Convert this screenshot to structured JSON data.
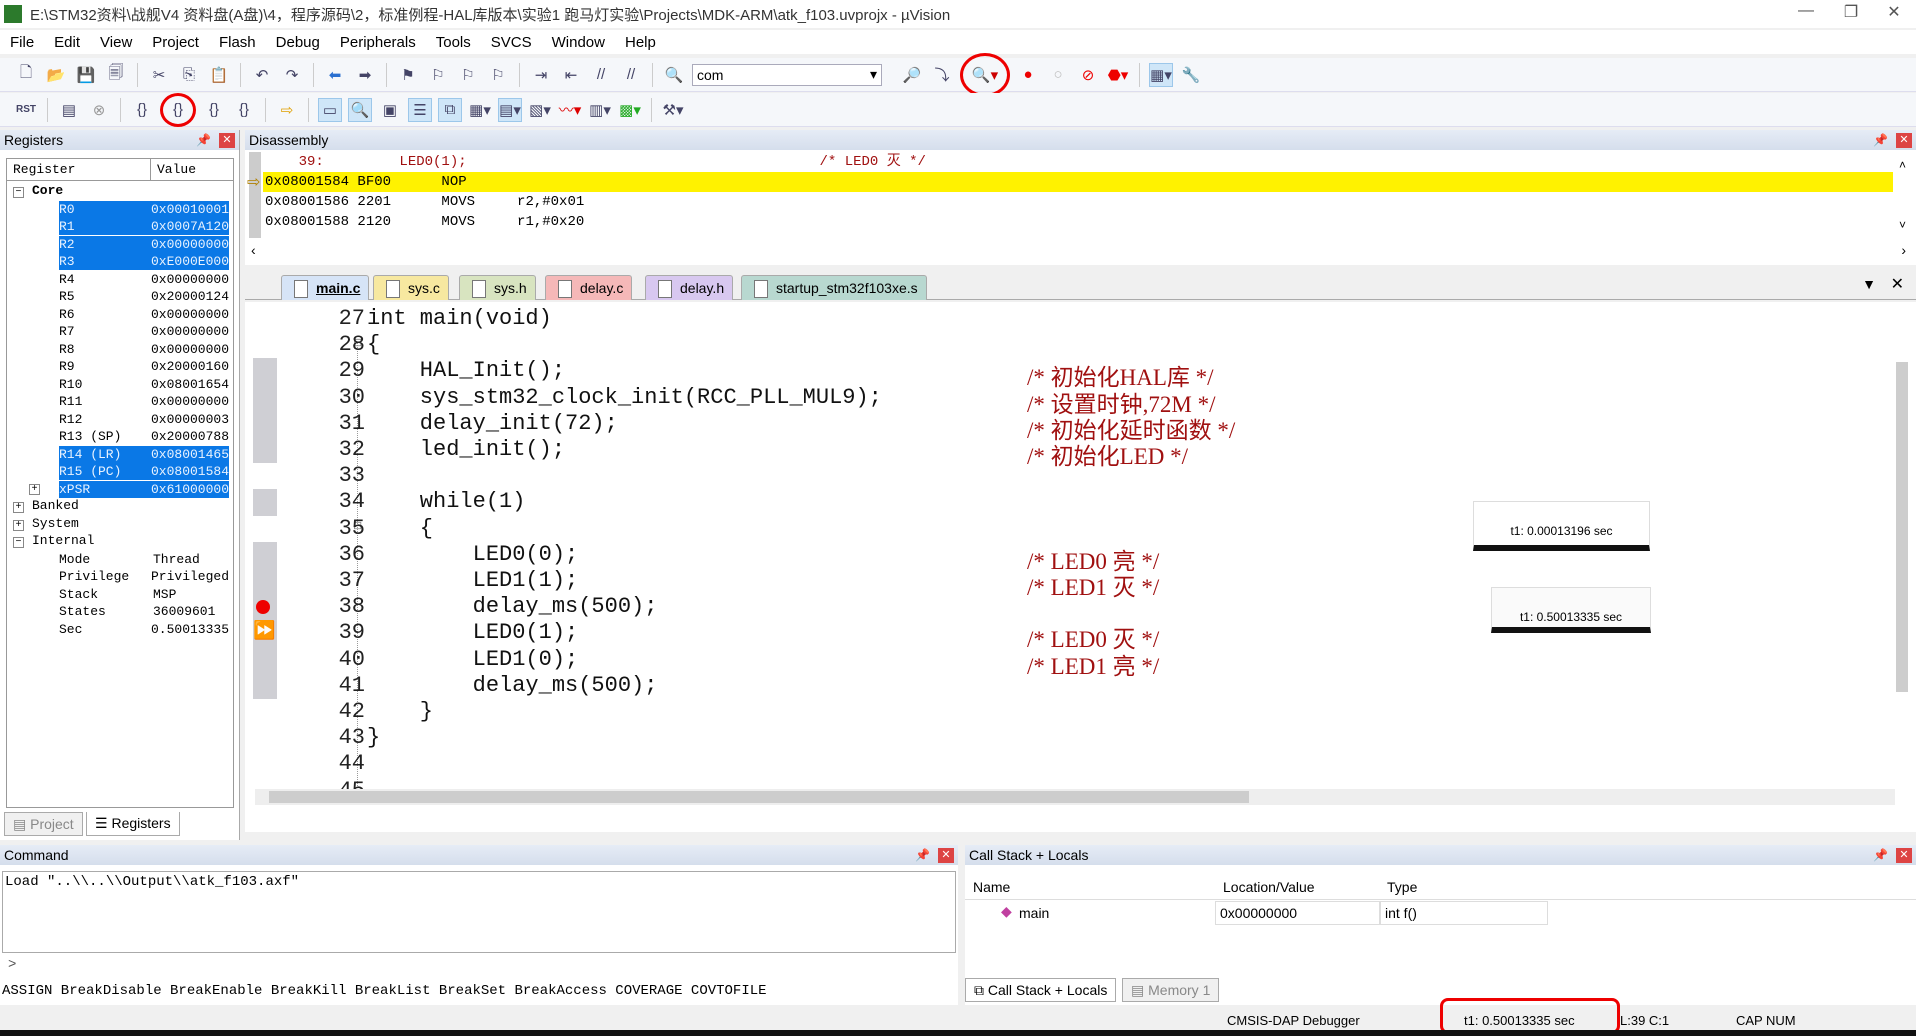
{
  "window": {
    "title": "E:\\STM32资料\\战舰V4 资料盘(A盘)\\4，程序源码\\2，标准例程-HAL库版本\\实验1 跑马灯实验\\Projects\\MDK-ARM\\atk_f103.uvprojx - µVision",
    "logo": "V"
  },
  "menu": [
    "File",
    "Edit",
    "View",
    "Project",
    "Flash",
    "Debug",
    "Peripherals",
    "Tools",
    "SVCS",
    "Window",
    "Help"
  ],
  "toolbar": {
    "target_combo": "com"
  },
  "registers": {
    "title": "Registers",
    "col_register": "Register",
    "col_value": "Value",
    "core_label": "Core",
    "core": [
      {
        "name": "R0",
        "value": "0x00010001",
        "selected": true
      },
      {
        "name": "R1",
        "value": "0x0007A120",
        "selected": true
      },
      {
        "name": "R2",
        "value": "0x00000000",
        "selected": true
      },
      {
        "name": "R3",
        "value": "0xE000E000",
        "selected": true
      },
      {
        "name": "R4",
        "value": "0x00000000"
      },
      {
        "name": "R5",
        "value": "0x20000124"
      },
      {
        "name": "R6",
        "value": "0x00000000"
      },
      {
        "name": "R7",
        "value": "0x00000000"
      },
      {
        "name": "R8",
        "value": "0x00000000"
      },
      {
        "name": "R9",
        "value": "0x20000160"
      },
      {
        "name": "R10",
        "value": "0x08001654"
      },
      {
        "name": "R11",
        "value": "0x00000000"
      },
      {
        "name": "R12",
        "value": "0x00000003"
      },
      {
        "name": "R13 (SP)",
        "value": "0x20000788"
      },
      {
        "name": "R14 (LR)",
        "value": "0x08001465",
        "selected": true
      },
      {
        "name": "R15 (PC)",
        "value": "0x08001584",
        "selected": true
      },
      {
        "name": "xPSR",
        "value": "0x61000000",
        "selected": true
      }
    ],
    "groups": [
      "Banked",
      "System",
      "Internal"
    ],
    "internal": [
      {
        "name": "Mode",
        "value": "Thread"
      },
      {
        "name": "Privilege",
        "value": "Privileged"
      },
      {
        "name": "Stack",
        "value": "MSP"
      },
      {
        "name": "States",
        "value": "36009601"
      },
      {
        "name": "Sec",
        "value": "0.50013335"
      }
    ],
    "tabs": [
      "Project",
      "Registers"
    ]
  },
  "disassembly": {
    "title": "Disassembly",
    "rows": [
      "    39:         LED0(1);                                          /* LED0 灭 */",
      "0x08001584 BF00      NOP",
      "0x08001586 2201      MOVS     r2,#0x01",
      "0x08001588 2120      MOVS     r1,#0x20"
    ]
  },
  "file_tabs": [
    {
      "label": "main.c",
      "color": "#d6e4f7"
    },
    {
      "label": "sys.c",
      "color": "#f7e8a0"
    },
    {
      "label": "sys.h",
      "color": "#d8e4c0"
    },
    {
      "label": "delay.c",
      "color": "#f5b8b8"
    },
    {
      "label": "delay.h",
      "color": "#d8c8f0"
    },
    {
      "label": "startup_stm32f103xe.s",
      "color": "#b8d8d0"
    }
  ],
  "editor": {
    "lines": [
      {
        "n": "27",
        "code": "int main(void)"
      },
      {
        "n": "28",
        "code": "{"
      },
      {
        "n": "29",
        "code": "    HAL_Init();",
        "comment": "/* 初始化HAL库 */"
      },
      {
        "n": "30",
        "code": "    sys_stm32_clock_init(RCC_PLL_MUL9);",
        "comment": "/* 设置时钟,72M */"
      },
      {
        "n": "31",
        "code": "    delay_init(72);",
        "comment": "/* 初始化延时函数 */"
      },
      {
        "n": "32",
        "code": "    led_init();",
        "comment": "/* 初始化LED */"
      },
      {
        "n": "33",
        "code": ""
      },
      {
        "n": "34",
        "code": "    while(1)"
      },
      {
        "n": "35",
        "code": "    {"
      },
      {
        "n": "36",
        "code": "        LED0(0);",
        "comment": "/* LED0 亮 */"
      },
      {
        "n": "37",
        "code": "        LED1(1);",
        "comment": "/* LED1 灭 */"
      },
      {
        "n": "38",
        "code": "        delay_ms(500);"
      },
      {
        "n": "39",
        "code": "        LED0(1);",
        "comment": "/* LED0 灭 */"
      },
      {
        "n": "40",
        "code": "        LED1(0);",
        "comment": "/* LED1 亮 */"
      },
      {
        "n": "41",
        "code": "        delay_ms(500);"
      },
      {
        "n": "42",
        "code": "    }"
      },
      {
        "n": "43",
        "code": "}"
      },
      {
        "n": "44",
        "code": ""
      },
      {
        "n": "45",
        "code": ""
      }
    ],
    "breakpoint_line": "38",
    "current_line": "39"
  },
  "tooltips": [
    "t1: 0.00013196 sec",
    "t1: 0.50013335 sec"
  ],
  "command": {
    "title": "Command",
    "output": "Load \"..\\\\..\\\\Output\\\\atk_f103.axf\"",
    "prompt": ">",
    "hint": "ASSIGN BreakDisable BreakEnable BreakKill BreakList BreakSet BreakAccess COVERAGE COVTOFILE"
  },
  "callstack": {
    "title": "Call Stack + Locals",
    "cols": [
      "Name",
      "Location/Value",
      "Type"
    ],
    "rows": [
      {
        "name": "main",
        "value": "0x00000000",
        "type": "int f()"
      }
    ],
    "tabs": [
      "Call Stack + Locals",
      "Memory 1"
    ]
  },
  "status": {
    "debugger": "CMSIS-DAP Debugger",
    "time": "t1: 0.50013335 sec",
    "pos": "L:39 C:1",
    "caps": "CAP",
    "num": "NUM"
  },
  "colors": {
    "selection": "#0a78e6",
    "current_line": "#fff200",
    "comment": "#a01010",
    "annotation": "#e00000"
  }
}
